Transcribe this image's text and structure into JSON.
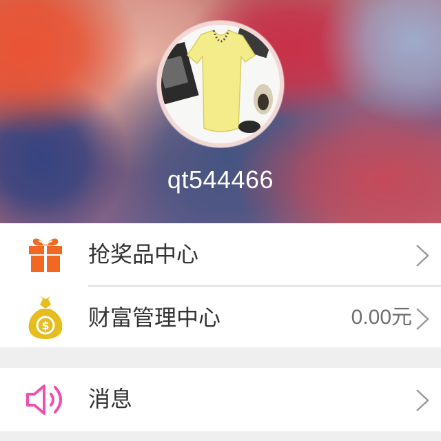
{
  "profile": {
    "username": "qt544466"
  },
  "menu": {
    "prize_center": {
      "label": "抢奖品中心",
      "icon": "gift-icon"
    },
    "wealth_center": {
      "label": "财富管理中心",
      "value": "0.00元",
      "icon": "money-bag-icon"
    },
    "messages": {
      "label": "消息",
      "icon": "speaker-icon"
    }
  },
  "colors": {
    "gift_icon": "#f26722",
    "money_icon": "#e6bd1f",
    "speaker_icon": "#f04fb0",
    "label_text": "#333333",
    "value_text": "#6e6e6e",
    "page_bg": "#efefef"
  }
}
